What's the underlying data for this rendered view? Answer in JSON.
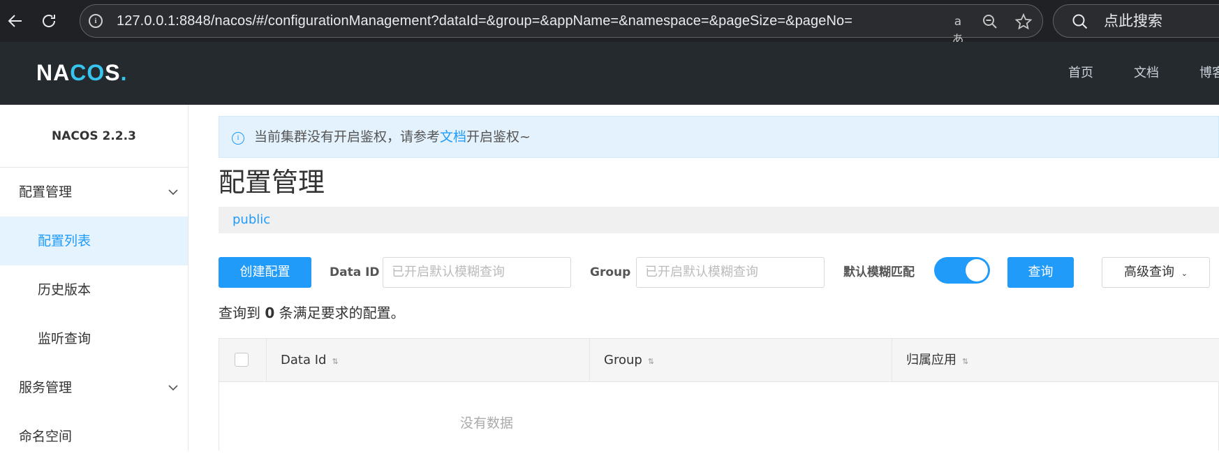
{
  "browser": {
    "url": "127.0.0.1:8848/nacos/#/configurationManagement?dataId=&group=&appName=&namespace=&pageSize=&pageNo=",
    "search_placeholder": "点此搜索",
    "icons": [
      "back-icon",
      "refresh-icon",
      "site-info-icon",
      "read-aloud-icon",
      "zoom-out-icon",
      "favorite-star-icon",
      "search-icon"
    ]
  },
  "header": {
    "logo": "NACOS.",
    "nav": [
      "首页",
      "文档",
      "博客"
    ]
  },
  "sidebar": {
    "version": "NACOS 2.2.3",
    "groups": [
      {
        "label": "配置管理",
        "items": [
          "配置列表",
          "历史版本",
          "监听查询"
        ]
      },
      {
        "label": "服务管理"
      },
      {
        "label": "命名空间"
      }
    ],
    "active_item": "配置列表"
  },
  "notice": {
    "text_before": "当前集群没有开启鉴权，请参考",
    "link": "文档",
    "text_after": "开启鉴权~"
  },
  "main": {
    "title": "配置管理",
    "namespace": "public",
    "create_button": "创建配置",
    "data_id_label": "Data ID",
    "data_id_placeholder": "已开启默认模糊查询",
    "group_label": "Group",
    "group_placeholder": "已开启默认模糊查询",
    "fuzzy_label": "默认模糊匹配",
    "fuzzy_on": true,
    "query_button": "查询",
    "advanced_button": "高级查询",
    "result_prefix": "查询到",
    "result_count": "0",
    "result_suffix": "条满足要求的配置。"
  },
  "table": {
    "columns": [
      "Data Id",
      "Group",
      "归属应用"
    ],
    "empty_text": "没有数据"
  },
  "colors": {
    "accent": "#209bfa",
    "header_bg": "#252a2f",
    "notice_bg": "#e3f2fd"
  }
}
